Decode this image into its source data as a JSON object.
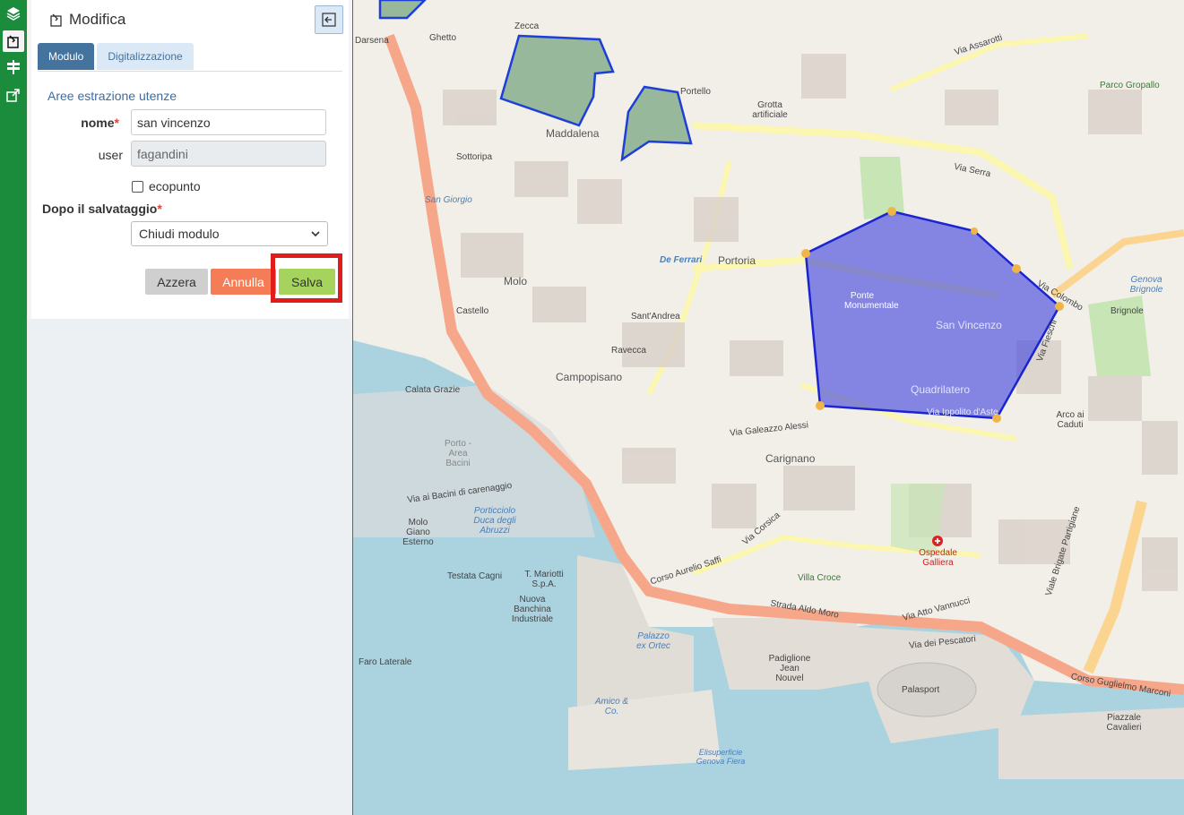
{
  "toolbar": {
    "icons": [
      "layers-icon",
      "edit-icon",
      "signpost-icon",
      "share-icon"
    ]
  },
  "panel": {
    "title": "Modifica",
    "tabs": [
      {
        "label": "Modulo",
        "active": true
      },
      {
        "label": "Digitalizzazione",
        "active": false
      }
    ],
    "section_title": "Aree estrazione utenze",
    "fields": {
      "nome_label": "nome",
      "nome_value": "san vincenzo",
      "user_label": "user",
      "user_value": "fagandini",
      "ecopunto_label": "ecopunto",
      "ecopunto_checked": false,
      "after_save_label": "Dopo il salvataggio",
      "after_save_value": "Chiudi modulo",
      "required_mark": "*"
    },
    "buttons": {
      "reset": "Azzera",
      "cancel": "Annulla",
      "save": "Salva"
    }
  },
  "map": {
    "labels": {
      "darsena": "Darsena",
      "ghetto": "Ghetto",
      "zecca": "Zecca",
      "portello": "Portello",
      "grotta": "Grotta artificiale",
      "maddalena": "Maddalena",
      "sottoripa": "Sottoripa",
      "san_giorgio": "San Giorgio",
      "de_ferrari": "De Ferrari",
      "portoria": "Portoria",
      "molo": "Molo",
      "castello": "Castello",
      "sant_andrea": "Sant'Andrea",
      "ravecca": "Ravecca",
      "campopisano": "Campopisano",
      "carignano": "Carignano",
      "ponte_monumentale": "Ponte Monumentale",
      "san_vincenzo": "San Vincenzo",
      "quadrilatero": "Quadrilatero",
      "brignole": "Brignole",
      "genova_brignole": "Genova Brignole",
      "porco_gropallo": "Parco Gropallo",
      "calata_grazie": "Calata Grazie",
      "porto_area_bacini": "Porto - Area Bacini",
      "porticciolo": "Porticciolo Duca degli Abruzzi",
      "molo_giano": "Molo Giano Esterno",
      "testata_cagni": "Testata Cagni",
      "t_mariotti": "T. Mariotti S.p.A.",
      "nuova_banchina": "Nuova Banchina Industriale",
      "palazzo_ex_ortec": "Palazzo ex Ortec",
      "padiglione": "Padiglione Jean Nouvel",
      "palasport": "Palasport",
      "ospedale": "Ospedale Galliera",
      "villa_croce": "Villa Croce",
      "faro": "Faro Laterale",
      "amico": "Amico & Co.",
      "piazzale": "Piazzale Cavalieri",
      "eliporto": "Elisuperficie Genova Fiera",
      "via_assarotti": "Via Assarotti",
      "via_serra": "Via Serra",
      "via_xx": "Via Galeazzo Alessi",
      "corso_aurelio": "Corso Aurelio Saffi",
      "strada_aldo_moro": "Strada Aldo Moro",
      "via_bacini": "Via ai Bacini di carenaggio",
      "corso_marconi": "Corso Guglielmo Marconi",
      "viale_brigate": "Viale Brigate Partigiane",
      "via_fieschi": "Via Fieschi",
      "via_colombo": "Via Colombo",
      "via_ippolito": "Via Ippolito d'Aste",
      "via_corsica": "Via Corsica",
      "via_vannucci": "Via Atto Vannucci",
      "via_pescatori": "Via dei Pescatori",
      "sauro": "Arco ai Caduti"
    },
    "colors": {
      "selected_polygon": "#3a3ee0",
      "park_polygon": "#4d8a5a",
      "main_road": "#f7a789",
      "secondary_road": "#fbf6b0",
      "sea": "#aad3df",
      "land": "#f2efe9"
    }
  }
}
